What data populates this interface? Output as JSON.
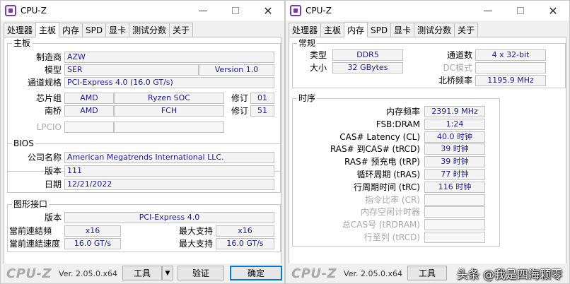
{
  "left": {
    "title": "CPU-Z",
    "tabs": [
      "处理器",
      "主板",
      "内存",
      "SPD",
      "显卡",
      "测试分数",
      "关于"
    ],
    "active_tab": "主板",
    "mainboard": {
      "group_title": "主板",
      "manufacturer_label": "制造商",
      "manufacturer": "AZW",
      "model_label": "模型",
      "model": "SER",
      "model_version": "Version 1.0",
      "bus_label": "通道规格",
      "bus": "PCI-Express 4.0 (16.0 GT/s)",
      "chipset_label": "芯片组",
      "chipset_vendor": "AMD",
      "chipset_name": "Ryzen SOC",
      "chipset_rev_label": "修订",
      "chipset_rev": "01",
      "southbridge_label": "南桥",
      "southbridge_vendor": "AMD",
      "southbridge_name": "FCH",
      "southbridge_rev_label": "修订",
      "southbridge_rev": "51",
      "lpcio_label": "LPCIO"
    },
    "bios": {
      "group_title": "BIOS",
      "brand_label": "公司名称",
      "brand": "American Megatrends International LLC.",
      "version_label": "版本",
      "version": "111",
      "date_label": "日期",
      "date": "12/21/2022"
    },
    "graphics": {
      "group_title": "图形接口",
      "version_label": "版本",
      "version": "PCI-Express 4.0",
      "cur_width_label": "當前連結頻",
      "cur_width": "x16",
      "max_width_label": "最大支持",
      "max_width": "x16",
      "cur_speed_label": "當前連結速度",
      "cur_speed": "16.0 GT/s",
      "max_speed_label": "最大支持",
      "max_speed": "16.0 GT/s"
    },
    "footer": {
      "brand": "CPU-Z",
      "version": "Ver. 2.05.0.x64",
      "tools_label": "工具",
      "validate_label": "验证",
      "ok_label": "确定"
    }
  },
  "right": {
    "title": "CPU-Z",
    "tabs": [
      "处理器",
      "主板",
      "内存",
      "SPD",
      "显卡",
      "测试分数",
      "关于"
    ],
    "active_tab": "内存",
    "general": {
      "group_title": "常规",
      "type_label": "类型",
      "type": "DDR5",
      "channels_label": "通道数",
      "channels": "4 x 32-bit",
      "size_label": "大小",
      "size": "32 GBytes",
      "dc_label": "DC模式",
      "nb_label": "北桥频率",
      "nb_freq": "1195.9 MHz"
    },
    "timings": {
      "group_title": "时序",
      "rows": [
        {
          "label": "内存频率",
          "value": "2391.9 MHz",
          "dim": false
        },
        {
          "label": "FSB:DRAM",
          "value": "1:24",
          "dim": false
        },
        {
          "label": "CAS# Latency (CL)",
          "value": "40.0 时钟",
          "dim": false
        },
        {
          "label": "RAS# 到CAS# (tRCD)",
          "value": "39 时钟",
          "dim": false
        },
        {
          "label": "RAS# 预充电 (tRP)",
          "value": "39 时钟",
          "dim": false
        },
        {
          "label": "循环周期 (tRAS)",
          "value": "77 时钟",
          "dim": false
        },
        {
          "label": "行周期时间 (tRC)",
          "value": "116 时钟",
          "dim": false
        },
        {
          "label": "指令比率 (CR)",
          "value": "",
          "dim": true
        },
        {
          "label": "内存空闲计时器",
          "value": "",
          "dim": true
        },
        {
          "label": "总CAS号 (tRDRAM)",
          "value": "",
          "dim": true
        },
        {
          "label": "行至列 (tRCD)",
          "value": "",
          "dim": true
        }
      ]
    },
    "footer": {
      "brand": "CPU-Z",
      "version": "Ver. 2.05.0.x64",
      "tools_label": "工具"
    }
  },
  "watermark": "头条 @我是四海颗零"
}
